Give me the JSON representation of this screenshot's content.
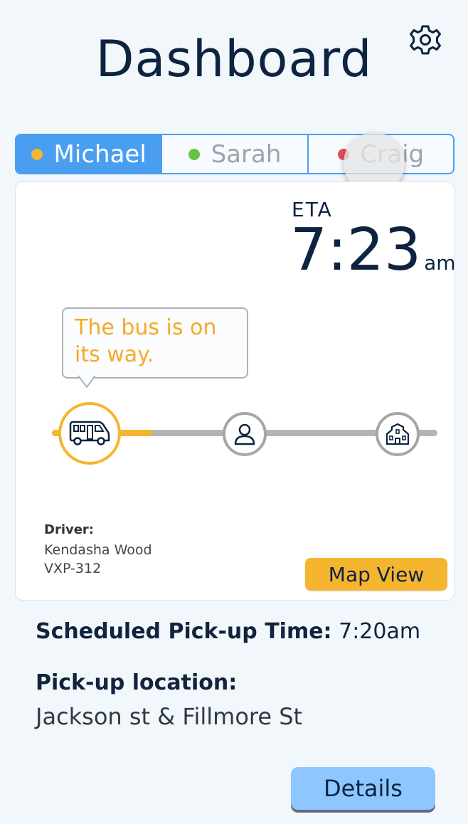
{
  "header": {
    "title": "Dashboard",
    "settings_icon": "gear-icon"
  },
  "tabs": [
    {
      "label": "Michael",
      "status_color": "#f6b52e",
      "active": true
    },
    {
      "label": "Sarah",
      "status_color": "#6cbf4a",
      "active": false
    },
    {
      "label": "Craig",
      "status_color": "#e0505a",
      "active": false
    }
  ],
  "eta": {
    "label": "ETA",
    "time": "7:23",
    "suffix": "am"
  },
  "status": {
    "message": "The bus is on its way.",
    "progress_stage": "bus",
    "icons": [
      "bus-icon",
      "person-icon",
      "school-icon"
    ]
  },
  "driver": {
    "label": "Driver:",
    "name": "Kendasha Wood",
    "plate": "VXP-312"
  },
  "map_button": "Map View",
  "schedule": {
    "label": "Scheduled Pick-up Time:",
    "time": "7:20am"
  },
  "pickup": {
    "label": "Pick-up location:",
    "location": "Jackson st & Fillmore St"
  },
  "details_button": "Details",
  "colors": {
    "accent_blue": "#4a9ef0",
    "accent_orange": "#f6b52e",
    "navy": "#0d2340"
  }
}
